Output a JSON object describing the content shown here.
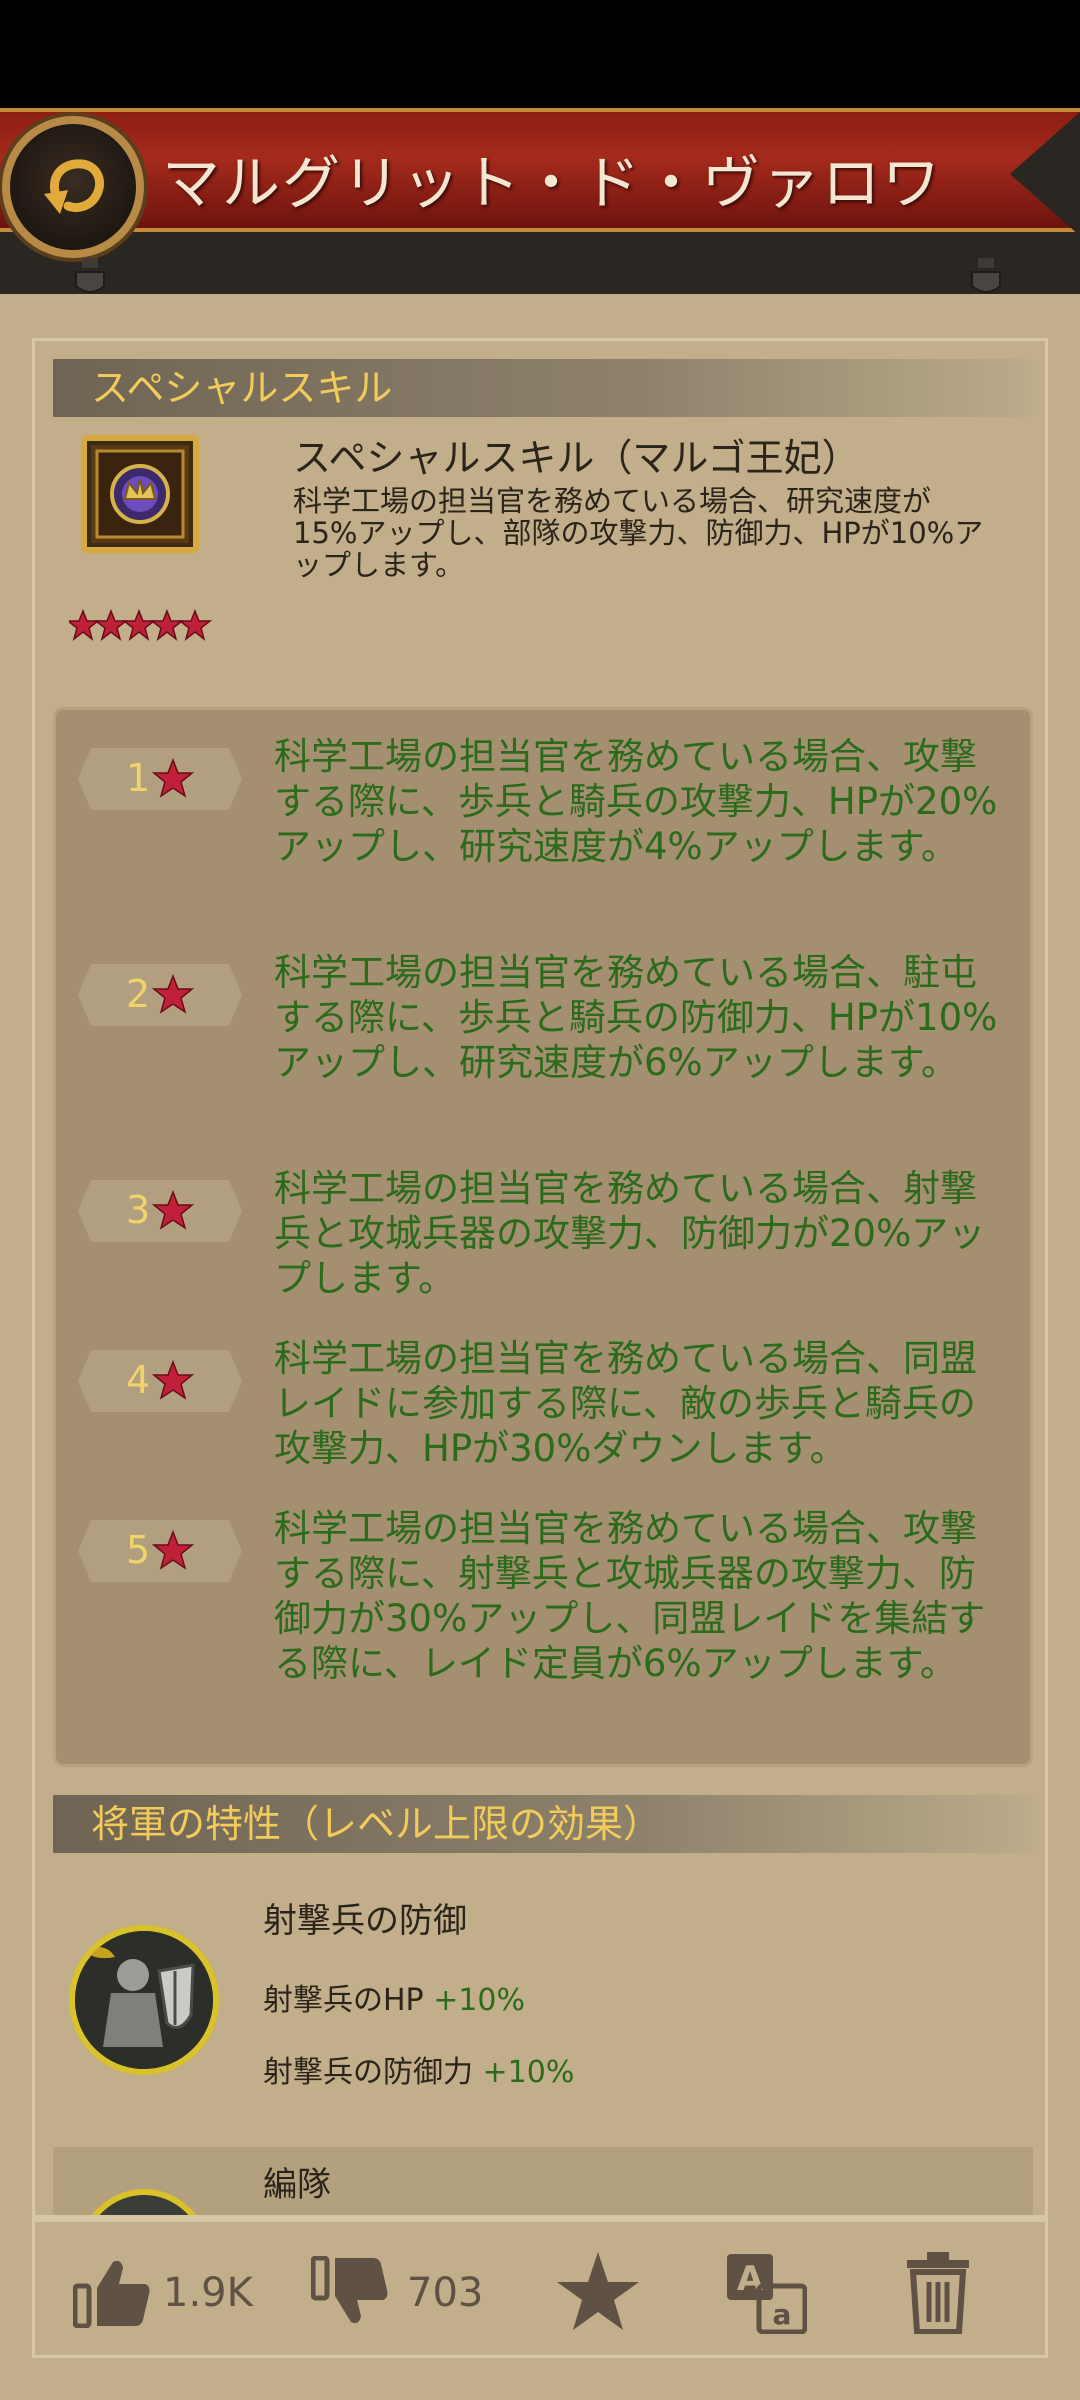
{
  "header": {
    "title": "マルグリット・ド・ヴァロワ"
  },
  "special_skill": {
    "section_title": "スペシャルスキル",
    "name": "スペシャルスキル（マルゴ王妃）",
    "description": "科学工場の担当官を務めている場合、研究速度が15%アップし、部隊の攻撃力、防御力、HPが10%アップします。",
    "star_rating": 5,
    "levels": [
      {
        "level": "1",
        "text": "科学工場の担当官を務めている場合、攻撃する際に、歩兵と騎兵の攻撃力、HPが20%アップし、研究速度が4%アップします。"
      },
      {
        "level": "2",
        "text": "科学工場の担当官を務めている場合、駐屯する際に、歩兵と騎兵の防御力、HPが10%アップし、研究速度が6%アップします。"
      },
      {
        "level": "3",
        "text": "科学工場の担当官を務めている場合、射撃兵と攻城兵器の攻撃力、防御力が20%アップします。"
      },
      {
        "level": "4",
        "text": "科学工場の担当官を務めている場合、同盟レイドに参加する際に、敵の歩兵と騎兵の攻撃力、HPが30%ダウンします。"
      },
      {
        "level": "5",
        "text": "科学工場の担当官を務めている場合、攻撃する際に、射撃兵と攻城兵器の攻撃力、防御力が30%アップし、同盟レイドを集結する際に、レイド定員が6%アップします。"
      }
    ]
  },
  "traits": {
    "section_title": "将軍の特性（レベル上限の効果）",
    "items": [
      {
        "name": "射撃兵の防御",
        "stats": [
          {
            "label": "射撃兵のHP",
            "value": "+10%"
          },
          {
            "label": "射撃兵の防御力",
            "value": "+10%"
          }
        ]
      },
      {
        "name": "編隊"
      }
    ]
  },
  "actions": {
    "likes": "1.9K",
    "dislikes": "703"
  },
  "colors": {
    "banner_red": "#a52a1c",
    "panel_bg": "#c2ae8a",
    "section_title": "#f2cb5a",
    "level_text_green": "#2c6a1c",
    "star_red": "#c0203a"
  }
}
